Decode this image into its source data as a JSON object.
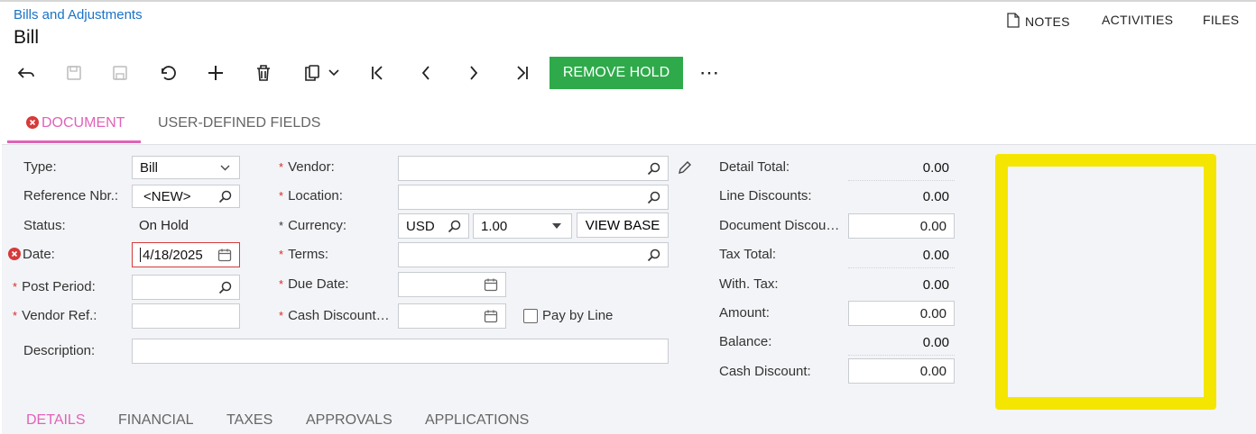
{
  "header": {
    "breadcrumb": "Bills and Adjustments",
    "title": "Bill",
    "links": {
      "notes": "NOTES",
      "activities": "ACTIVITIES",
      "files": "FILES"
    }
  },
  "toolbar": {
    "remove_hold": "REMOVE HOLD",
    "more": "⋯"
  },
  "tabs": {
    "document": "DOCUMENT",
    "user_defined": "USER-DEFINED FIELDS"
  },
  "form": {
    "type_label": "Type:",
    "type_value": "Bill",
    "ref_label": "Reference Nbr.:",
    "ref_value": "<NEW>",
    "status_label": "Status:",
    "status_value": "On Hold",
    "date_label": "Date:",
    "date_value": "4/18/2025",
    "post_period_label": "Post Period:",
    "post_period_value": "",
    "vendor_ref_label": "Vendor Ref.:",
    "vendor_ref_value": "",
    "description_label": "Description:",
    "description_value": "",
    "vendor_label": "Vendor:",
    "vendor_value": "",
    "location_label": "Location:",
    "location_value": "",
    "currency_label": "Currency:",
    "currency_value": "USD",
    "rate_value": "1.00",
    "view_base": "VIEW BASE",
    "terms_label": "Terms:",
    "terms_value": "",
    "due_date_label": "Due Date:",
    "due_date_value": "",
    "cash_discount_label": "Cash Discount…",
    "cash_discount_value": "",
    "pay_by_line_label": "Pay by Line",
    "required_mark": "*"
  },
  "totals": {
    "detail_total_label": "Detail Total:",
    "detail_total": "0.00",
    "line_discounts_label": "Line Discounts:",
    "line_discounts": "0.00",
    "document_discount_label": "Document Discou…",
    "document_discount": "0.00",
    "tax_total_label": "Tax Total:",
    "tax_total": "0.00",
    "with_tax_label": "With. Tax:",
    "with_tax": "0.00",
    "amount_label": "Amount:",
    "amount": "0.00",
    "balance_label": "Balance:",
    "balance": "0.00",
    "cash_discount_label": "Cash Discount:",
    "cash_discount": "0.00"
  },
  "bottom_tabs": [
    "DETAILS",
    "FINANCIAL",
    "TAXES",
    "APPROVALS",
    "APPLICATIONS"
  ],
  "colors": {
    "accent": "#e062b8",
    "primary_button": "#2faa4b",
    "link": "#1a73c8",
    "error": "#d63a3a",
    "highlight": "#f4e600"
  }
}
